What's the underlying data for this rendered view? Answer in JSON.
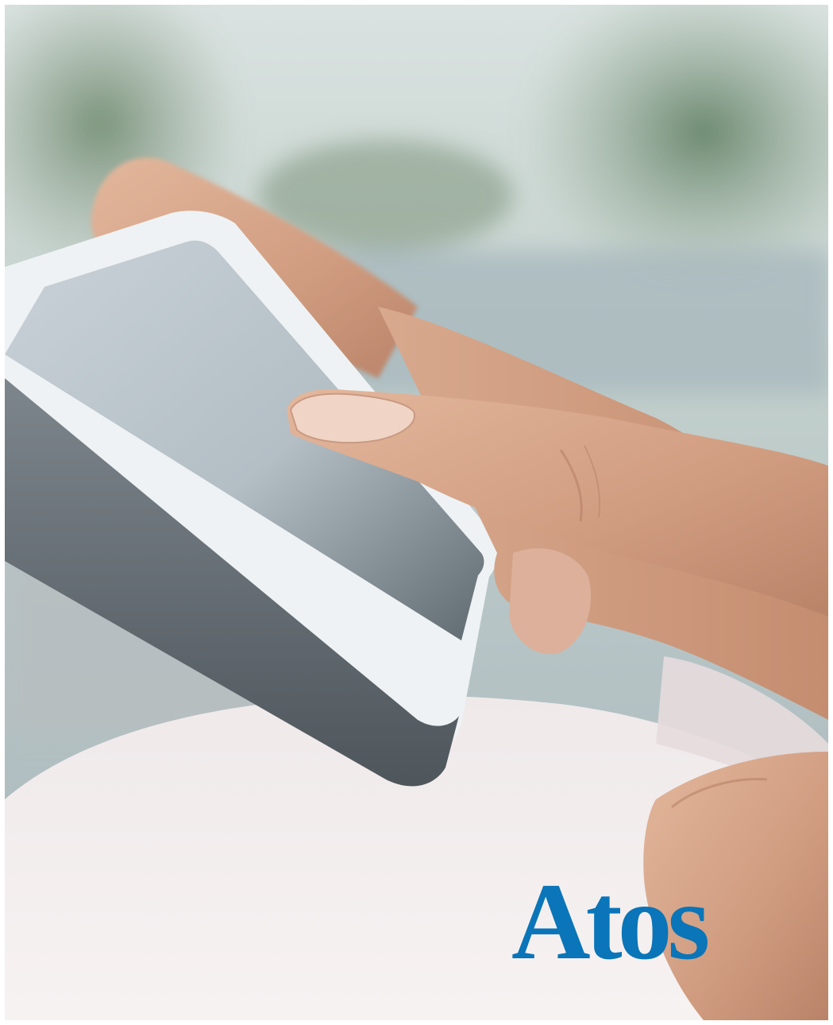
{
  "photo": {
    "subject": "hand-tapping-smartphone-screen"
  },
  "logo": {
    "text": "Atos",
    "color": "#0a75b8"
  },
  "colors": {
    "background": "#ffffff",
    "brand_blue": "#0a75b8",
    "skin": "#d9a88d",
    "phone_frame": "#e9eef1",
    "phone_screen": "#bcc6cc",
    "clothing": "#f3eded"
  }
}
